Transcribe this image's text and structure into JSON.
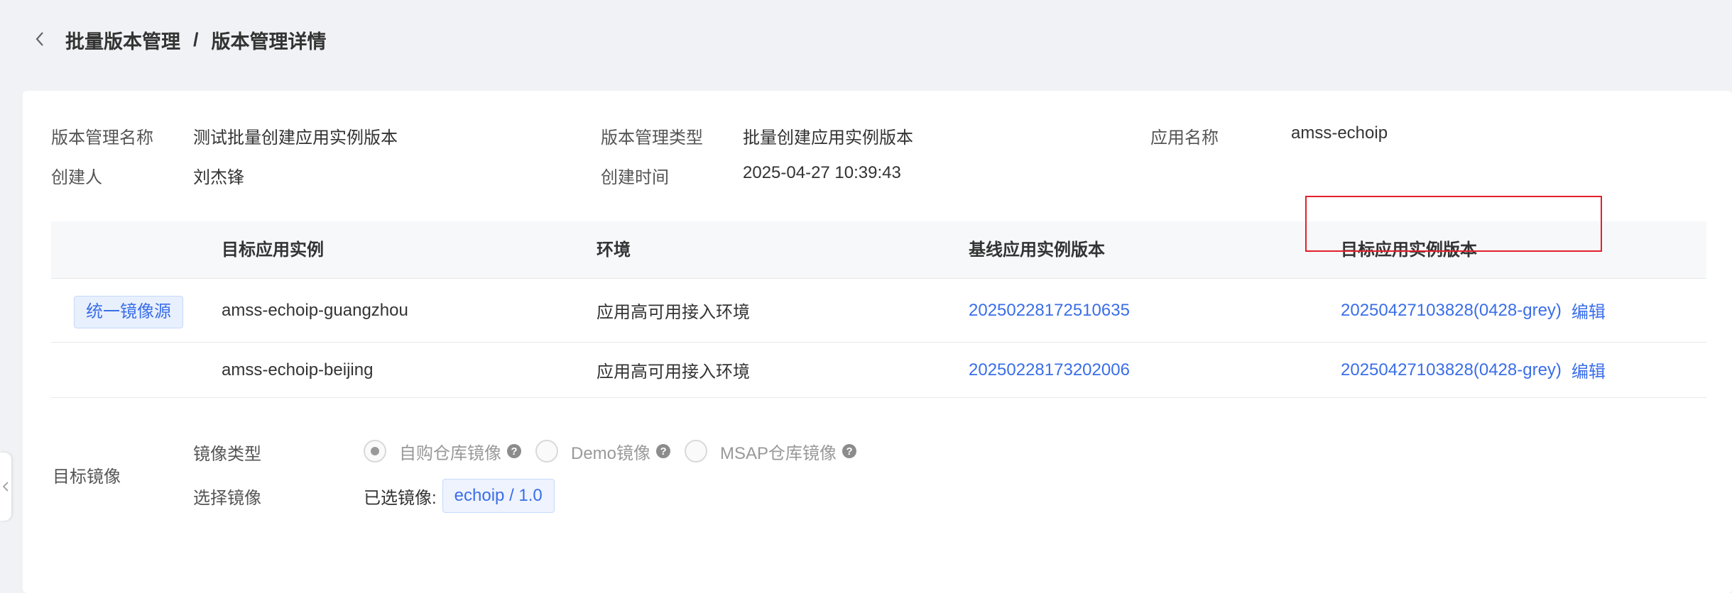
{
  "header": {
    "back_icon": "chevron-left-icon",
    "breadcrumb_parent": "批量版本管理",
    "breadcrumb_sep": "/",
    "breadcrumb_current": "版本管理详情"
  },
  "info": {
    "name_label": "版本管理名称",
    "name_value": "测试批量创建应用实例版本",
    "type_label": "版本管理类型",
    "type_value": "批量创建应用实例版本",
    "app_label": "应用名称",
    "app_value": "amss-echoip",
    "creator_label": "创建人",
    "creator_value": "刘杰锋",
    "created_time_label": "创建时间",
    "created_time_value": "2025-04-27 10:39:43"
  },
  "table": {
    "columns": [
      "目标应用实例",
      "环境",
      "基线应用实例版本",
      "目标应用实例版本"
    ],
    "unify_source_label": "统一镜像源",
    "edit_label": "编辑",
    "rows": [
      {
        "instance": "amss-echoip-guangzhou",
        "env": "应用高可用接入环境",
        "baseline_version": "20250228172510635",
        "target_version": "20250427103828(0428-grey)"
      },
      {
        "instance": "amss-echoip-beijing",
        "env": "应用高可用接入环境",
        "baseline_version": "20250228173202006",
        "target_version": "20250427103828(0428-grey)"
      }
    ]
  },
  "target_image": {
    "section_label": "目标镜像",
    "image_type_label": "镜像类型",
    "select_image_label": "选择镜像",
    "options": [
      {
        "label": "自购仓库镜像",
        "checked": true
      },
      {
        "label": "Demo镜像",
        "checked": false
      },
      {
        "label": "MSAP仓库镜像",
        "checked": false
      }
    ],
    "help_icon": "question-circle-icon",
    "selected_label": "已选镜像:",
    "selected_value": "echoip / 1.0"
  },
  "colors": {
    "accent": "#3a6ee8",
    "highlight": "#e5202b",
    "background": "#f0f2f5"
  }
}
